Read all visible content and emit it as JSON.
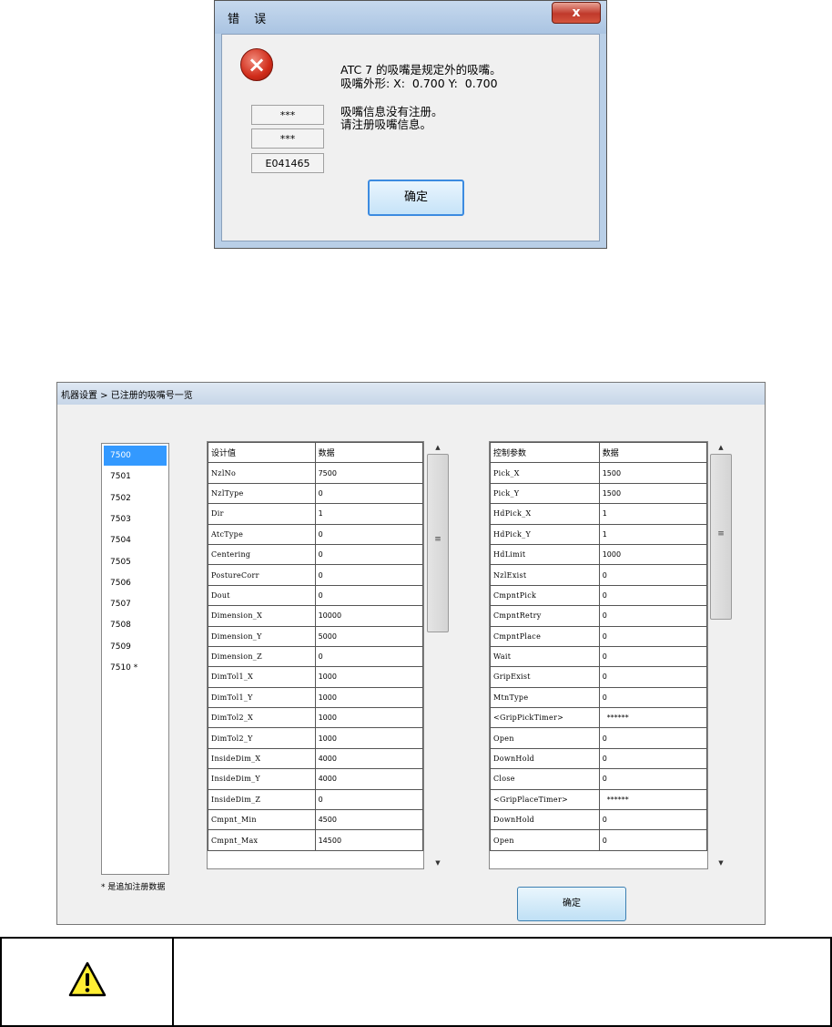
{
  "error_dialog": {
    "title": "错 误",
    "close_symbol": "x",
    "message_lines": [
      "ATC 7 的吸嘴是规定外的吸嘴。",
      "吸嘴外形: X:  0.700 Y:  0.700"
    ],
    "info_lines": [
      "吸嘴信息没有注册。",
      "请注册吸嘴信息。"
    ],
    "codes": [
      "***",
      "***",
      "E041465"
    ],
    "ok_label": "确定"
  },
  "nozzle_window": {
    "breadcrumb": "机器设置 > 已注册的吸嘴号一览",
    "nozzles": [
      {
        "label": "7500",
        "selected": true
      },
      {
        "label": "7501"
      },
      {
        "label": "7502"
      },
      {
        "label": "7503"
      },
      {
        "label": "7504"
      },
      {
        "label": "7505"
      },
      {
        "label": "7506"
      },
      {
        "label": "7507"
      },
      {
        "label": "7508"
      },
      {
        "label": "7509"
      },
      {
        "label": "7510 *"
      }
    ],
    "list_note": "* 是追加注册数据",
    "design_table": {
      "headers": [
        "设计值",
        "数据"
      ],
      "rows": [
        [
          "NzlNo",
          "7500"
        ],
        [
          "NzlType",
          "0"
        ],
        [
          "Dir",
          "1"
        ],
        [
          "AtcType",
          "0"
        ],
        [
          "Centering",
          "0"
        ],
        [
          "PostureCorr",
          "0"
        ],
        [
          "Dout",
          "0"
        ],
        [
          "Dimension_X",
          "10000"
        ],
        [
          "Dimension_Y",
          "5000"
        ],
        [
          "Dimension_Z",
          "0"
        ],
        [
          "DimTol1_X",
          "1000"
        ],
        [
          "DimTol1_Y",
          "1000"
        ],
        [
          "DimTol2_X",
          "1000"
        ],
        [
          "DimTol2_Y",
          "1000"
        ],
        [
          "InsideDim_X",
          "4000"
        ],
        [
          "InsideDim_Y",
          "4000"
        ],
        [
          "InsideDim_Z",
          "0"
        ],
        [
          "Cmpnt_Min",
          "4500"
        ],
        [
          "Cmpnt_Max",
          "14500"
        ]
      ]
    },
    "control_table": {
      "headers": [
        "控制参数",
        "数据"
      ],
      "rows": [
        [
          "Pick_X",
          "1500"
        ],
        [
          "Pick_Y",
          "1500"
        ],
        [
          "HdPick_X",
          "1"
        ],
        [
          "HdPick_Y",
          "1"
        ],
        [
          "HdLimit",
          "1000"
        ],
        [
          "NzlExist",
          "0"
        ],
        [
          "CmpntPick",
          "0"
        ],
        [
          "CmpntRetry",
          "0"
        ],
        [
          "CmpntPlace",
          "0"
        ],
        [
          "Wait",
          "0"
        ],
        [
          "GripExist",
          "0"
        ],
        [
          "MtnType",
          "0"
        ],
        [
          "<GripPickTimer>",
          "******"
        ],
        [
          "Open",
          "0"
        ],
        [
          "DownHold",
          "0"
        ],
        [
          "Close",
          "0"
        ],
        [
          "<GripPlaceTimer>",
          "******"
        ],
        [
          "DownHold",
          "0"
        ],
        [
          "Open",
          "0"
        ]
      ]
    },
    "scroll_grip": "≡",
    "ok_label": "确定"
  },
  "warning": {
    "icon": "warning-triangle-icon"
  }
}
